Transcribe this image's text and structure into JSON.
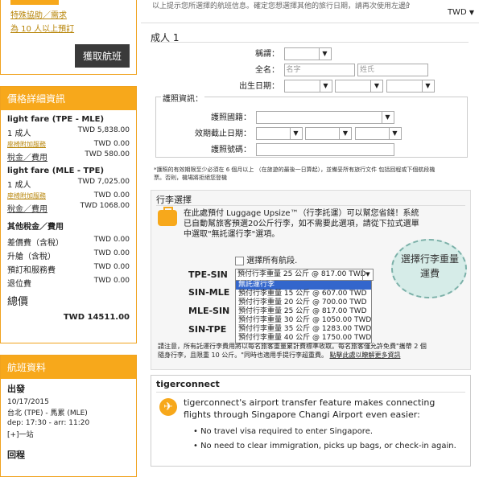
{
  "sidebar": {
    "top_links": [
      "特殊協助／需求",
      "為 10 人以上預訂"
    ],
    "get_flights_btn": "獲取航班",
    "price_title": "價格詳細資訊",
    "legs": [
      {
        "title": "light fare (TPE - MLE)",
        "pax": "1 成人",
        "pax_price": "TWD 5,838.00",
        "addon_label": "座椅附加服務",
        "addon_price": "TWD 0.00",
        "tax_label": "稅金／費用",
        "tax_price": "TWD 580.00"
      },
      {
        "title": "light fare (MLE - TPE)",
        "pax": "1 成人",
        "pax_price": "TWD 7,025.00",
        "addon_label": "座椅附加服務",
        "addon_price": "TWD 0.00",
        "tax_label": "稅金／費用",
        "tax_price": "TWD 1068.00"
      }
    ],
    "other_title": "其他稅金／費用",
    "other_rows": [
      {
        "label": "差價費（含稅）",
        "price": "TWD 0.00"
      },
      {
        "label": "升艙（含稅）",
        "price": "TWD 0.00"
      },
      {
        "label": "預訂和服務費",
        "price": "TWD 0.00"
      },
      {
        "label": "退位費",
        "price": "TWD 0.00"
      }
    ],
    "total_label": "總價",
    "total_value": "TWD 14511.00",
    "flight_title": "航班資料",
    "depart_title": "出發",
    "depart_date": "10/17/2015",
    "depart_route": "台北 (TPE) - 馬累 (MLE)",
    "depart_time": "dep: 17:30 - arr: 11:20",
    "depart_stop": "[+]一站",
    "return_title": "回程"
  },
  "main": {
    "top_text": "以上提示您所選擇的航班信息。確定您想選擇其他的旅行日期，請再次使用左邊的航班搜索",
    "currency": "TWD",
    "adult_title": "成人 1",
    "salutation_label": "稱謂：",
    "fullname_label": "全名：",
    "firstname_ph": "名字",
    "lastname_ph": "姓氏",
    "dob_label": "出生日期：",
    "passport_legend": "護照資訊：",
    "nationality_label": "護照國籍：",
    "expiry_label": "效期截止日期：",
    "passport_no_label": "護照號碼：",
    "passport_note": "*護照的有效期限至少必須在 6 個月以上 （在旅遊的最後一日算起），並備妥所有旅行文件 包括回程或下個航段機票。否則，機場將拒絕您登機",
    "baggage_legend": "行李選擇",
    "baggage_text": "在此處預付 Luggage Upsize™（行李託運）可以幫您省錢！系統已自動幫旅客預選20公斤行李，如不需要此選項，請從下拉式選單中選取\"無託運行李\"選項。",
    "select_all_label": "選擇所有航段.",
    "routes": [
      "TPE-SIN",
      "SIN-MLE",
      "MLE-SIN",
      "SIN-TPE"
    ],
    "selected_option": "預付行李重量 25 公斤 @ 817.00 TWD",
    "dropdown_options": [
      "無託運行李",
      "預付行李重量 15 公斤 @ 607.00 TWD",
      "預付行李重量 20 公斤 @ 700.00 TWD",
      "預付行李重量 25 公斤 @ 817.00 TWD",
      "預付行李重量 30 公斤 @ 1050.00 TWD",
      "預付行李重量 35 公斤 @ 1283.00 TWD",
      "預付行李重量 40 公斤 @ 1750.00 TWD"
    ],
    "baggage_note_a": "請注意，所有託運行李費用將以每名旅客重量累計費標準收取。每名旅客僅允許免費\"攜帶 2 個隨身行李，且限重 10 公斤。\"同時也適用手提行李超重費。",
    "baggage_note_link": "點擊此處以瞭解更多資訊",
    "annotation": "選擇行李重量運費",
    "tiger_title": "tigerconnect",
    "tiger_text": "tigerconnect's airport transfer feature makes connecting flights through Singapore Changi Airport even easier:",
    "tiger_bullets": [
      "No travel visa required to enter Singapore.",
      "No need to clear immigration, picks up bags, or check-in again."
    ]
  },
  "colors": {
    "accent": "#f7a81b",
    "highlight": "#3366cc"
  }
}
